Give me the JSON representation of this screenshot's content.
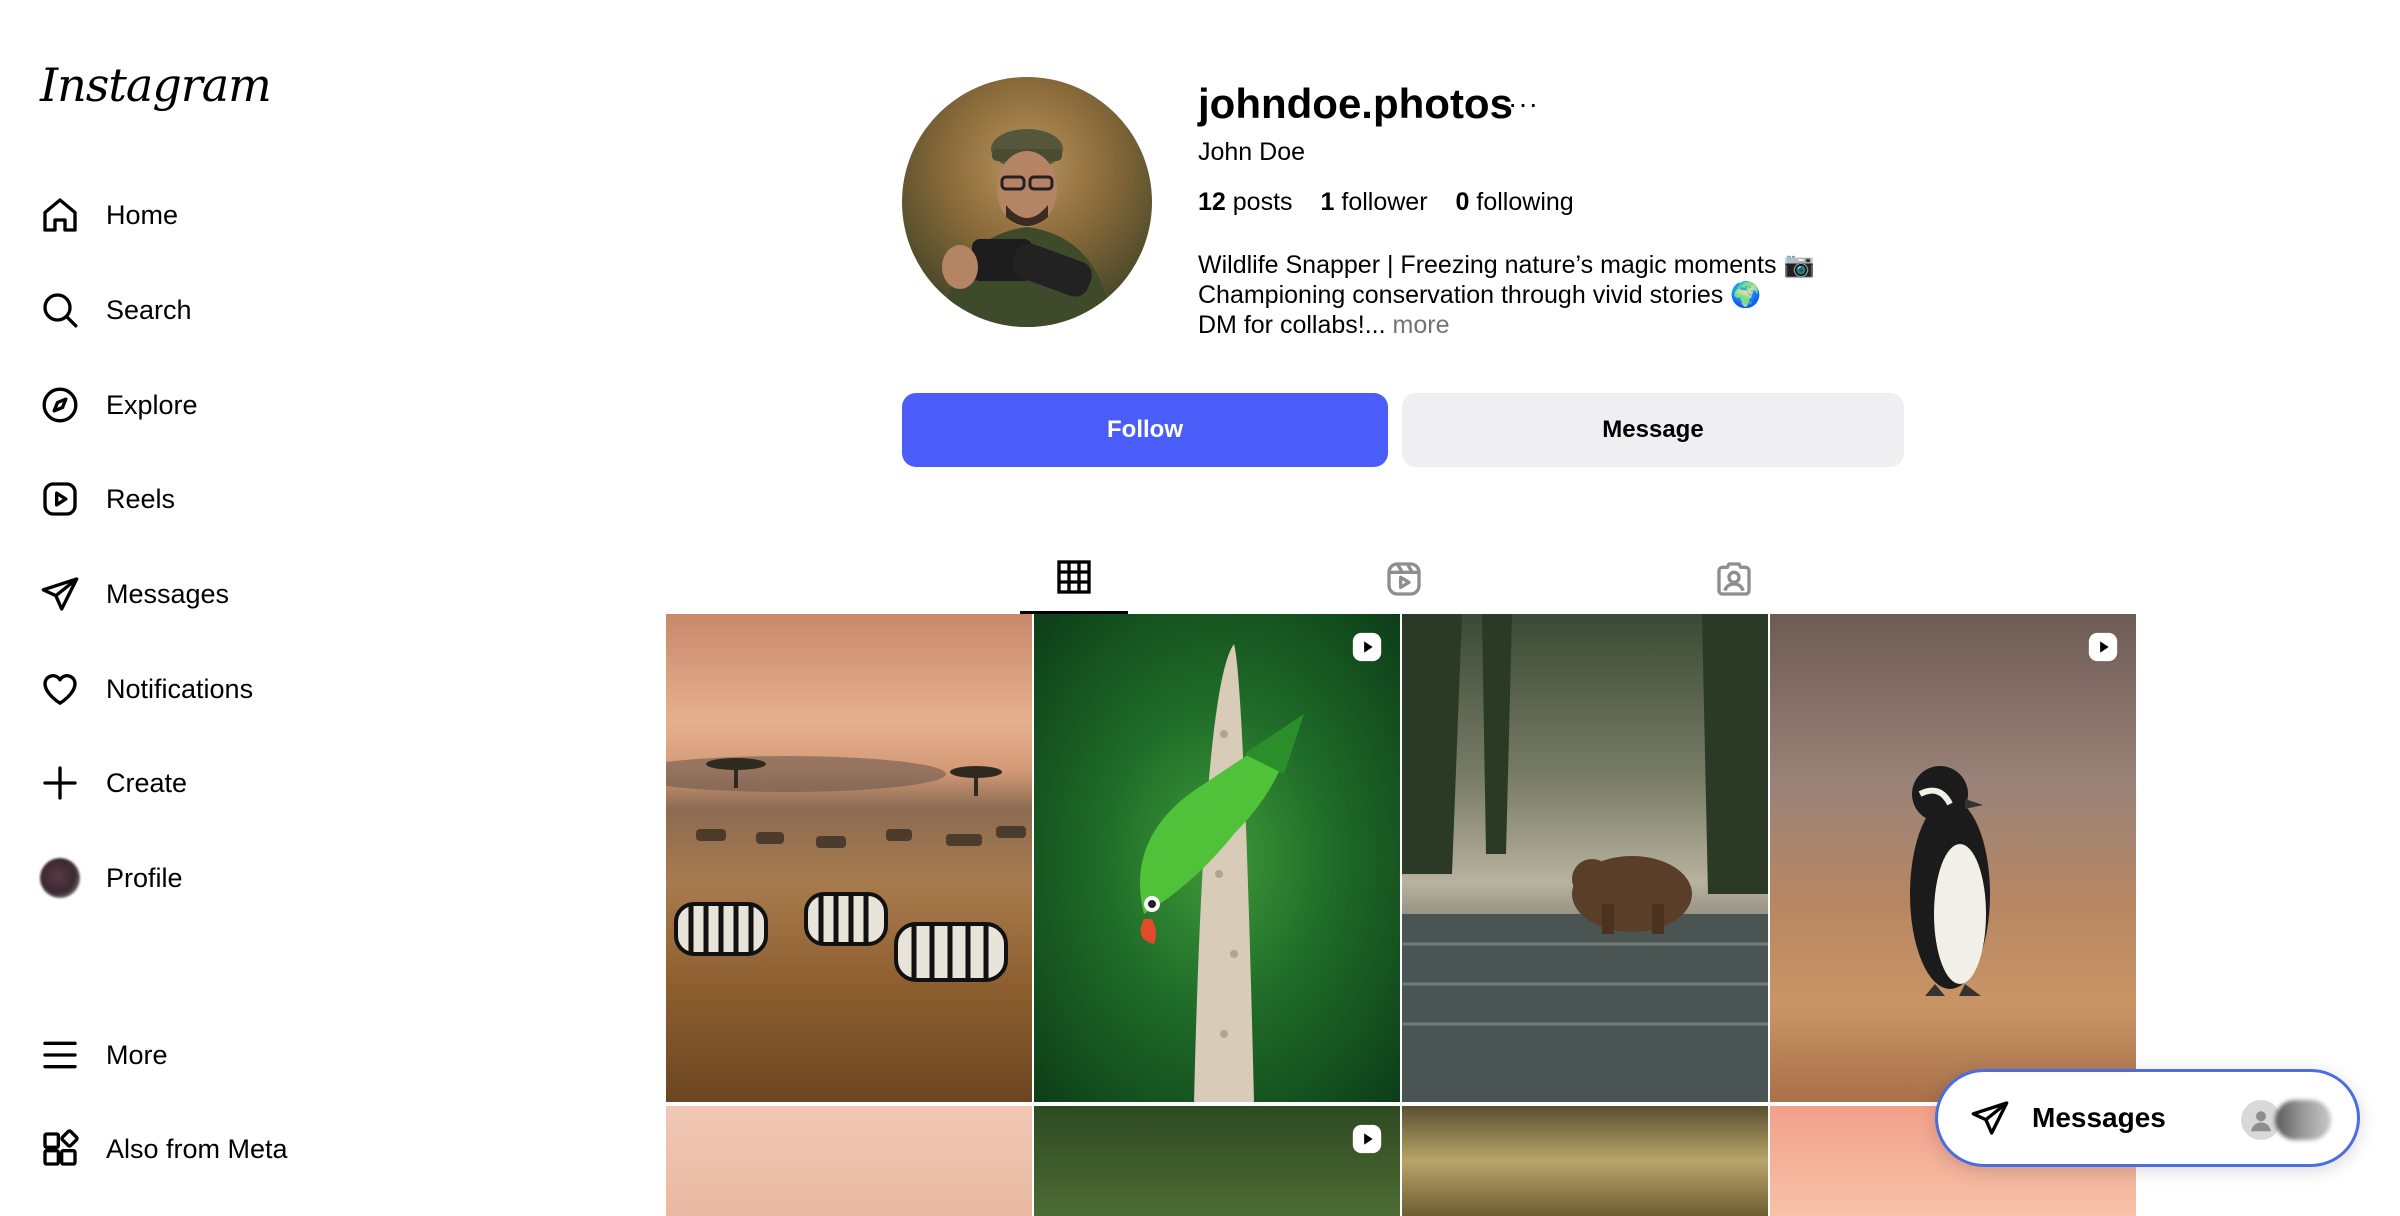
{
  "sidebar": {
    "logo": "Instagram",
    "items": [
      {
        "label": "Home",
        "icon": "home-icon"
      },
      {
        "label": "Search",
        "icon": "search-icon"
      },
      {
        "label": "Explore",
        "icon": "compass-icon"
      },
      {
        "label": "Reels",
        "icon": "reels-icon"
      },
      {
        "label": "Messages",
        "icon": "paper-plane-icon"
      },
      {
        "label": "Notifications",
        "icon": "heart-icon"
      },
      {
        "label": "Create",
        "icon": "plus-icon"
      },
      {
        "label": "Profile",
        "icon": "avatar"
      },
      {
        "label": "More",
        "icon": "hamburger-icon"
      },
      {
        "label": "Also from Meta",
        "icon": "meta-apps-icon"
      }
    ]
  },
  "profile": {
    "username": "johndoe.photos",
    "more": "···",
    "full_name": "John Doe",
    "stats": {
      "posts_count": "12",
      "posts_label": "posts",
      "followers_count": "1",
      "followers_label": "follower",
      "following_count": "0",
      "following_label": "following"
    },
    "bio": {
      "line1": "Wildlife Snapper | Freezing nature’s magic moments 📷",
      "line2": "Championing conservation through vivid stories 🌍",
      "line3": "DM for collabs!...",
      "more": "more"
    },
    "follow_label": "Follow",
    "message_label": "Message"
  },
  "tabs": [
    {
      "icon": "grid-icon",
      "active": true
    },
    {
      "icon": "reels-icon",
      "active": false
    },
    {
      "icon": "tagged-icon",
      "active": false
    }
  ],
  "posts": [
    {
      "subject": "zebras",
      "reel": false
    },
    {
      "subject": "parrot",
      "reel": true
    },
    {
      "subject": "bear",
      "reel": false
    },
    {
      "subject": "penguin",
      "reel": true
    },
    {
      "subject": "sunset",
      "reel": false
    },
    {
      "subject": "foliage",
      "reel": true
    },
    {
      "subject": "forest-light",
      "reel": false
    },
    {
      "subject": "pink-sky",
      "reel": false
    }
  ],
  "floating_messages": {
    "label": "Messages"
  },
  "colors": {
    "follow_button": "#4a5df9",
    "message_button": "#efeff1",
    "floating_border": "#4a6ee0"
  }
}
